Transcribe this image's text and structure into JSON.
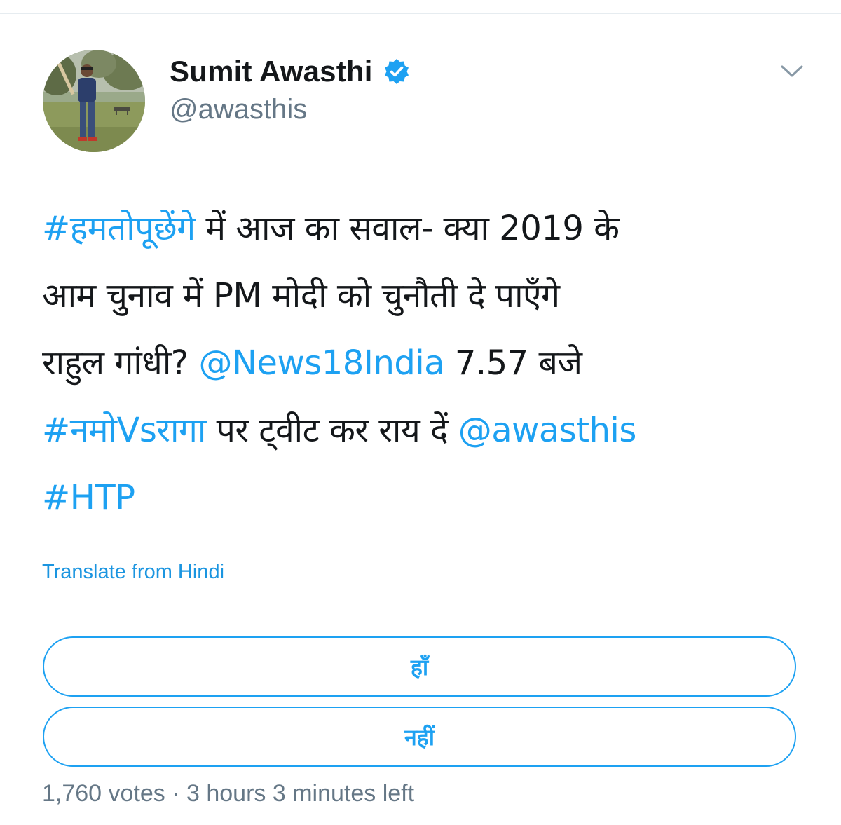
{
  "user": {
    "display_name": "Sumit Awasthi",
    "handle": "@awasthis",
    "verified": true
  },
  "tweet": {
    "lines": [
      [
        {
          "text": "#हमतोपूछेंगे",
          "type": "hashtag"
        },
        {
          "text": " में आज का सवाल- क्या 2019 के",
          "type": "text"
        }
      ],
      [
        {
          "text": "आम चुनाव में PM मोदी को चुनौती दे पाएँगे",
          "type": "text"
        }
      ],
      [
        {
          "text": "राहुल गांधी? ",
          "type": "text"
        },
        {
          "text": "@News18India",
          "type": "mention"
        },
        {
          "text": " 7.57 बजे",
          "type": "text"
        }
      ],
      [
        {
          "text": "#नमोVsरागा",
          "type": "hashtag"
        },
        {
          "text": " पर ट्वीट कर राय दें ",
          "type": "text"
        },
        {
          "text": "@awasthis",
          "type": "mention"
        }
      ],
      [
        {
          "text": "#HTP",
          "type": "hashtag"
        }
      ]
    ],
    "translate_label": "Translate from Hindi"
  },
  "poll": {
    "options": [
      {
        "label": "हाँ"
      },
      {
        "label": "नहीं"
      }
    ],
    "meta": "1,760 votes · 3 hours 3 minutes left"
  },
  "colors": {
    "link": "#1da1f2",
    "text": "#14171a",
    "muted": "#657786",
    "verified": "#1da1f2"
  },
  "icons": {
    "verified": "verified-badge-icon",
    "menu": "chevron-down-icon"
  }
}
